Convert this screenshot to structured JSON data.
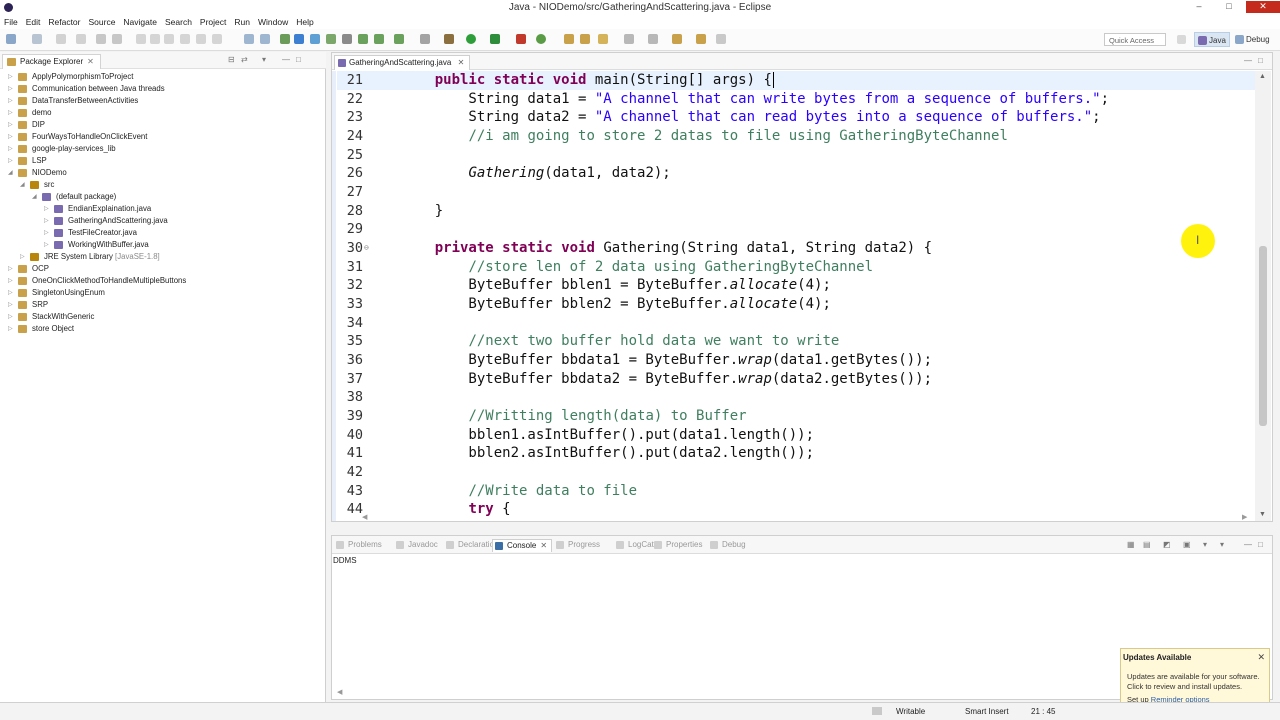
{
  "window": {
    "title": "Java - NIODemo/src/GatheringAndScattering.java - Eclipse",
    "min": "–",
    "max": "□",
    "close": "✕"
  },
  "menu": [
    "File",
    "Edit",
    "Refactor",
    "Source",
    "Navigate",
    "Search",
    "Project",
    "Run",
    "Window",
    "Help"
  ],
  "toolbar": {
    "quick_access": "Quick Access",
    "perspective_java": "Java",
    "perspective_debug": "Debug"
  },
  "package_explorer": {
    "tab_label": "Package Explorer",
    "items": [
      {
        "label": "ApplyPolymorphismToProject",
        "depth": 0,
        "arrow": "▷"
      },
      {
        "label": "Communication between Java threads",
        "depth": 0,
        "arrow": "▷"
      },
      {
        "label": "DataTransferBetweenActivities",
        "depth": 0,
        "arrow": "▷"
      },
      {
        "label": "demo",
        "depth": 0,
        "arrow": "▷"
      },
      {
        "label": "DIP",
        "depth": 0,
        "arrow": "▷"
      },
      {
        "label": "FourWaysToHandleOnClickEvent",
        "depth": 0,
        "arrow": "▷"
      },
      {
        "label": "google-play-services_lib",
        "depth": 0,
        "arrow": "▷"
      },
      {
        "label": "LSP",
        "depth": 0,
        "arrow": "▷"
      },
      {
        "label": "NIODemo",
        "depth": 0,
        "arrow": "◢"
      },
      {
        "label": "src",
        "depth": 1,
        "arrow": "◢"
      },
      {
        "label": "(default package)",
        "depth": 2,
        "arrow": "◢"
      },
      {
        "label": "EndianExplaination.java",
        "depth": 3,
        "arrow": "▷"
      },
      {
        "label": "GatheringAndScattering.java",
        "depth": 3,
        "arrow": "▷"
      },
      {
        "label": "TestFileCreator.java",
        "depth": 3,
        "arrow": "▷"
      },
      {
        "label": "WorkingWithBuffer.java",
        "depth": 3,
        "arrow": "▷"
      },
      {
        "label": "JRE System Library",
        "extra": " [JavaSE-1.8]",
        "depth": 1,
        "arrow": "▷"
      },
      {
        "label": "OCP",
        "depth": 0,
        "arrow": "▷"
      },
      {
        "label": "OneOnClickMethodToHandleMultipleButtons",
        "depth": 0,
        "arrow": "▷"
      },
      {
        "label": "SingletonUsingEnum",
        "depth": 0,
        "arrow": "▷"
      },
      {
        "label": "SRP",
        "depth": 0,
        "arrow": "▷"
      },
      {
        "label": "StackWithGeneric",
        "depth": 0,
        "arrow": "▷"
      },
      {
        "label": "store Object",
        "depth": 0,
        "arrow": "▷"
      }
    ]
  },
  "editor": {
    "tab_label": "GatheringAndScattering.java",
    "lines": [
      {
        "n": "21",
        "parts": [
          [
            "    "
          ],
          [
            "public",
            "kw"
          ],
          [
            " "
          ],
          [
            "static",
            "kw"
          ],
          [
            " "
          ],
          [
            "void",
            "kw"
          ],
          [
            " main(String[] args) {"
          ]
        ],
        "cur": true
      },
      {
        "n": "22",
        "parts": [
          [
            "        String data1 = "
          ],
          [
            "\"A channel that can write bytes from a sequence of buffers.\"",
            "str"
          ],
          [
            ";"
          ]
        ]
      },
      {
        "n": "23",
        "parts": [
          [
            "        String data2 = "
          ],
          [
            "\"A channel that can read bytes into a sequence of buffers.\"",
            "str"
          ],
          [
            ";"
          ]
        ]
      },
      {
        "n": "24",
        "parts": [
          [
            "        "
          ],
          [
            "//i am going to store 2 datas to file using GatheringByteChannel",
            "cm"
          ]
        ]
      },
      {
        "n": "25",
        "parts": [
          [
            ""
          ]
        ]
      },
      {
        "n": "26",
        "parts": [
          [
            "        "
          ],
          [
            "Gathering",
            "it"
          ],
          [
            "(data1, data2);"
          ]
        ]
      },
      {
        "n": "27",
        "parts": [
          [
            ""
          ]
        ]
      },
      {
        "n": "28",
        "parts": [
          [
            "    }"
          ]
        ]
      },
      {
        "n": "29",
        "parts": [
          [
            ""
          ]
        ]
      },
      {
        "n": "30",
        "parts": [
          [
            "    "
          ],
          [
            "private",
            "kw"
          ],
          [
            " "
          ],
          [
            "static",
            "kw"
          ],
          [
            " "
          ],
          [
            "void",
            "kw"
          ],
          [
            " Gathering(String data1, String data2) {"
          ]
        ],
        "fold": "⊖"
      },
      {
        "n": "31",
        "parts": [
          [
            "        "
          ],
          [
            "//store len of 2 data using GatheringByteChannel",
            "cm"
          ]
        ]
      },
      {
        "n": "32",
        "parts": [
          [
            "        ByteBuffer bblen1 = ByteBuffer."
          ],
          [
            "allocate",
            "it"
          ],
          [
            "(4);"
          ]
        ]
      },
      {
        "n": "33",
        "parts": [
          [
            "        ByteBuffer bblen2 = ByteBuffer."
          ],
          [
            "allocate",
            "it"
          ],
          [
            "(4);"
          ]
        ]
      },
      {
        "n": "34",
        "parts": [
          [
            ""
          ]
        ]
      },
      {
        "n": "35",
        "parts": [
          [
            "        "
          ],
          [
            "//next two buffer hold data we want to write",
            "cm"
          ]
        ]
      },
      {
        "n": "36",
        "parts": [
          [
            "        ByteBuffer bbdata1 = ByteBuffer."
          ],
          [
            "wrap",
            "it"
          ],
          [
            "(data1.getBytes());"
          ]
        ]
      },
      {
        "n": "37",
        "parts": [
          [
            "        ByteBuffer bbdata2 = ByteBuffer."
          ],
          [
            "wrap",
            "it"
          ],
          [
            "(data2.getBytes());"
          ]
        ]
      },
      {
        "n": "38",
        "parts": [
          [
            ""
          ]
        ]
      },
      {
        "n": "39",
        "parts": [
          [
            "        "
          ],
          [
            "//Writting length(data) to Buffer",
            "cm"
          ]
        ]
      },
      {
        "n": "40",
        "parts": [
          [
            "        bblen1.asIntBuffer().put(data1.length());"
          ]
        ]
      },
      {
        "n": "41",
        "parts": [
          [
            "        bblen2.asIntBuffer().put(data2.length());"
          ]
        ]
      },
      {
        "n": "42",
        "parts": [
          [
            ""
          ]
        ]
      },
      {
        "n": "43",
        "parts": [
          [
            "        "
          ],
          [
            "//Write data to file",
            "cm"
          ]
        ]
      },
      {
        "n": "44",
        "parts": [
          [
            "        "
          ],
          [
            "try",
            "kw"
          ],
          [
            " {"
          ]
        ]
      }
    ]
  },
  "console": {
    "tabs": [
      {
        "label": "Problems",
        "active": false
      },
      {
        "label": "Javadoc",
        "active": false
      },
      {
        "label": "Declaration",
        "active": false
      },
      {
        "label": "Console",
        "active": true,
        "close": "✕"
      },
      {
        "label": "Progress",
        "active": false
      },
      {
        "label": "LogCat",
        "active": false
      },
      {
        "label": "Properties",
        "active": false
      },
      {
        "label": "Debug",
        "active": false
      }
    ],
    "output": "DDMS"
  },
  "popup": {
    "title": "Updates Available",
    "body": "Updates are available for your software. Click to review and install updates.",
    "setup": "Set up ",
    "link": "Reminder options",
    "close": "✕"
  },
  "status": {
    "writable": "Writable",
    "insert_mode": "Smart Insert",
    "position": "21 : 45"
  },
  "colors": {
    "keyword": "#7f0055",
    "string": "#2a00ff",
    "comment": "#3f7f5f",
    "highlight": "#fff200"
  }
}
